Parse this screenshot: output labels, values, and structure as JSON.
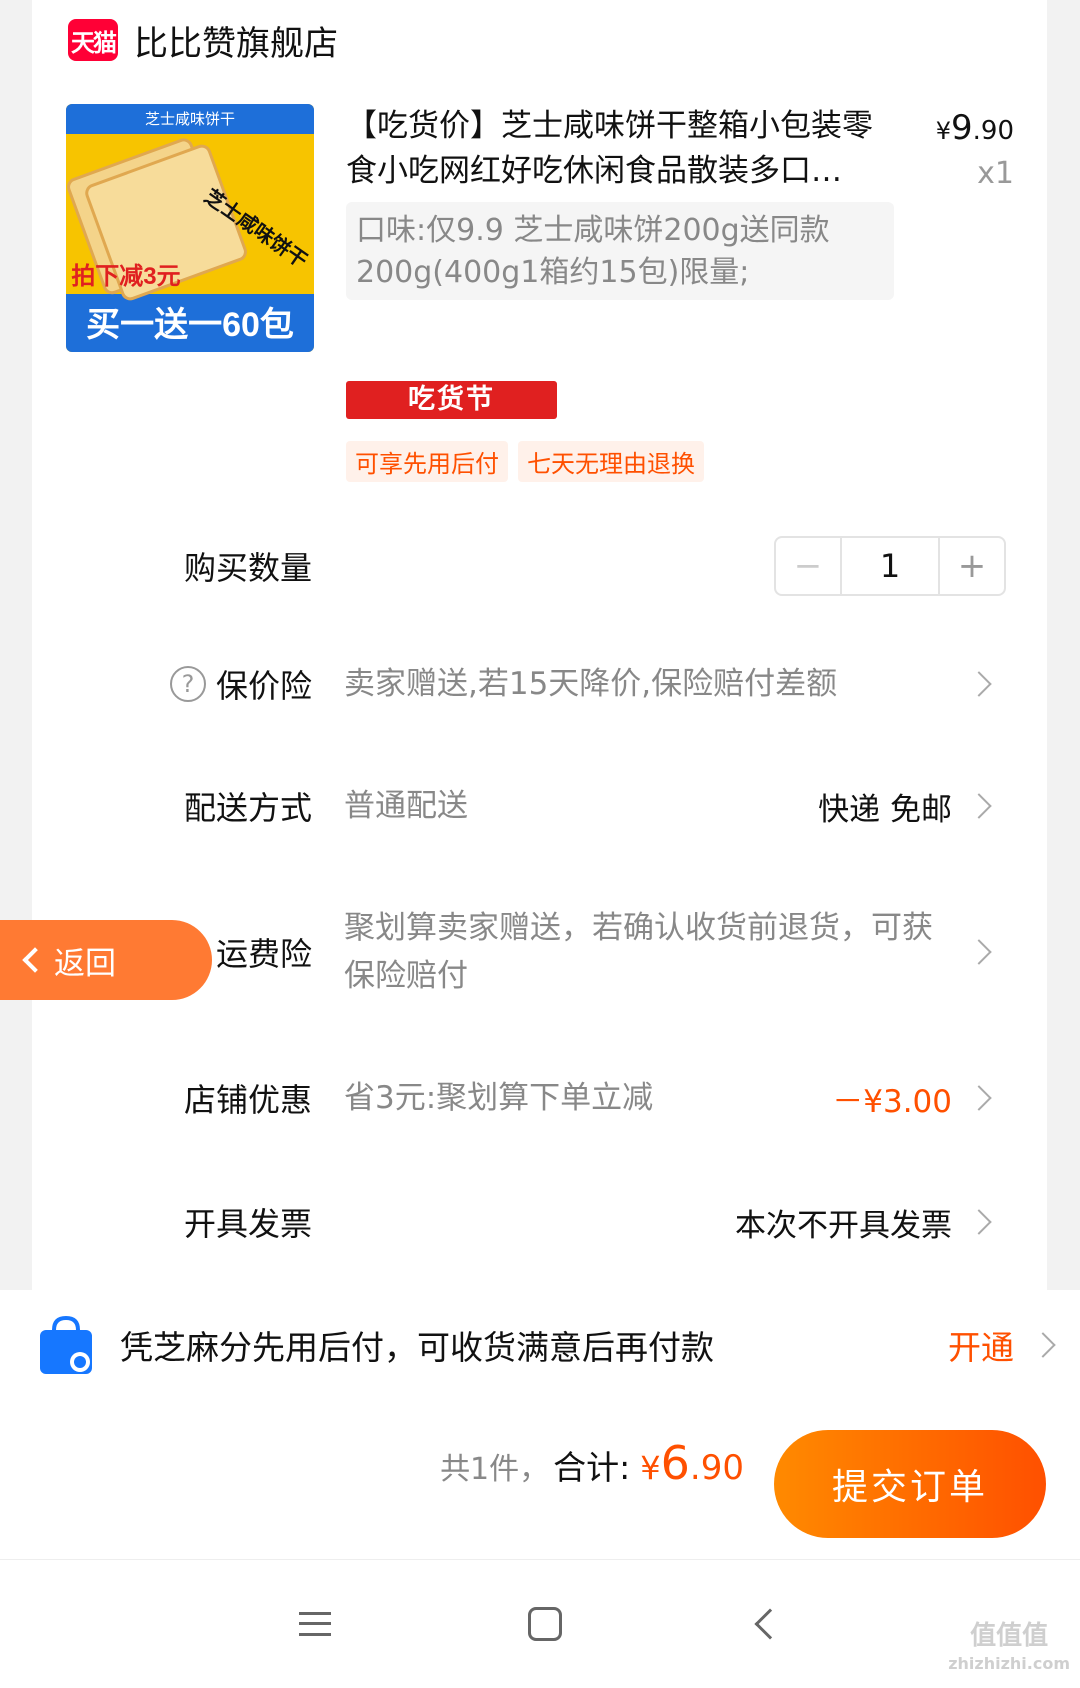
{
  "shop": {
    "logo": "天猫",
    "name": "比比赞旗舰店"
  },
  "product": {
    "title": "【吃货价】芝士咸味饼干整箱小包装零食小吃网红好吃休闲食品散装多口…",
    "price_currency": "¥",
    "price_int": "9",
    "price_dec": ".90",
    "quantity": "x1",
    "spec": "口味:仅9.9 芝士咸味饼200g送同款200g(400g1箱约15包)限量;",
    "badge": "吃货节",
    "tags": [
      "可享先用后付",
      "七天无理由退换"
    ],
    "image_text": {
      "top": "芝士咸味饼干",
      "mid": "芝士咸味饼干",
      "cut": "拍下减3元",
      "deal": "买一送一60包"
    }
  },
  "rows": {
    "quantity": {
      "label": "购买数量",
      "value": "1"
    },
    "price_protect": {
      "label": "保价险",
      "desc": "卖家赠送,若15天降价,保险赔付差额"
    },
    "delivery": {
      "label": "配送方式",
      "desc": "普通配送",
      "right": "快递 免邮"
    },
    "shipping_ins": {
      "label": "运费险",
      "desc": "聚划算卖家赠送，若确认收货前退货，可获保险赔付"
    },
    "discount": {
      "label": "店铺优惠",
      "desc": "省3元:聚划算下单立减",
      "right": "－¥3.00"
    },
    "invoice": {
      "label": "开具发票",
      "right": "本次不开具发票"
    }
  },
  "back_button": "返回",
  "pay_later": {
    "text": "凭芝麻分先用后付，可收货满意后再付款",
    "action": "开通"
  },
  "summary": {
    "count": "共1件，",
    "label": "合计:",
    "currency": "¥",
    "int": "6",
    "dec": ".90",
    "submit": "提交订单"
  },
  "watermark": {
    "line1": "值值值",
    "line2": "zhizhizhi.com"
  },
  "colors": {
    "accent": "#ff5000",
    "badge": "#e02020",
    "tmall": "#ff0036"
  }
}
